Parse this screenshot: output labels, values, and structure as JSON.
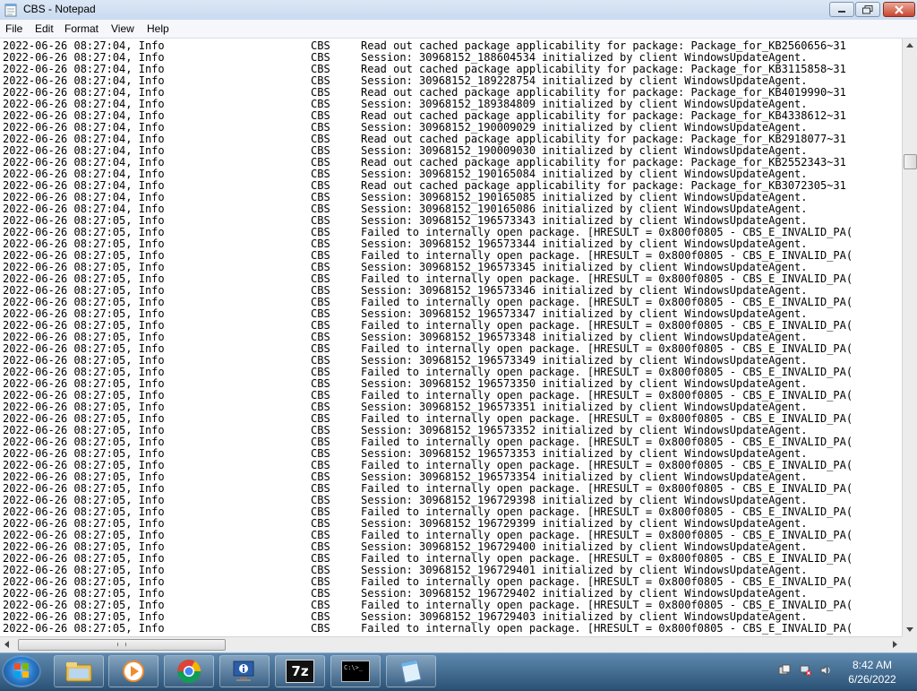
{
  "window": {
    "title": "CBS - Notepad"
  },
  "menu": [
    "File",
    "Edit",
    "Format",
    "View",
    "Help"
  ],
  "log_lines": [
    {
      "date": "2022-06-26 08:27:04, Info",
      "src": "CBS",
      "msg": "Read out cached package applicability for package: Package_for_KB2560656~31"
    },
    {
      "date": "2022-06-26 08:27:04, Info",
      "src": "CBS",
      "msg": "Session: 30968152_188604534 initialized by client WindowsUpdateAgent."
    },
    {
      "date": "2022-06-26 08:27:04, Info",
      "src": "CBS",
      "msg": "Read out cached package applicability for package: Package_for_KB3115858~31"
    },
    {
      "date": "2022-06-26 08:27:04, Info",
      "src": "CBS",
      "msg": "Session: 30968152_189228754 initialized by client WindowsUpdateAgent."
    },
    {
      "date": "2022-06-26 08:27:04, Info",
      "src": "CBS",
      "msg": "Read out cached package applicability for package: Package_for_KB4019990~31"
    },
    {
      "date": "2022-06-26 08:27:04, Info",
      "src": "CBS",
      "msg": "Session: 30968152_189384809 initialized by client WindowsUpdateAgent."
    },
    {
      "date": "2022-06-26 08:27:04, Info",
      "src": "CBS",
      "msg": "Read out cached package applicability for package: Package_for_KB4338612~31"
    },
    {
      "date": "2022-06-26 08:27:04, Info",
      "src": "CBS",
      "msg": "Session: 30968152_190009029 initialized by client WindowsUpdateAgent."
    },
    {
      "date": "2022-06-26 08:27:04, Info",
      "src": "CBS",
      "msg": "Read out cached package applicability for package: Package_for_KB2918077~31"
    },
    {
      "date": "2022-06-26 08:27:04, Info",
      "src": "CBS",
      "msg": "Session: 30968152_190009030 initialized by client WindowsUpdateAgent."
    },
    {
      "date": "2022-06-26 08:27:04, Info",
      "src": "CBS",
      "msg": "Read out cached package applicability for package: Package_for_KB2552343~31"
    },
    {
      "date": "2022-06-26 08:27:04, Info",
      "src": "CBS",
      "msg": "Session: 30968152_190165084 initialized by client WindowsUpdateAgent."
    },
    {
      "date": "2022-06-26 08:27:04, Info",
      "src": "CBS",
      "msg": "Read out cached package applicability for package: Package_for_KB3072305~31"
    },
    {
      "date": "2022-06-26 08:27:04, Info",
      "src": "CBS",
      "msg": "Session: 30968152_190165085 initialized by client WindowsUpdateAgent."
    },
    {
      "date": "2022-06-26 08:27:04, Info",
      "src": "CBS",
      "msg": "Session: 30968152_190165086 initialized by client WindowsUpdateAgent."
    },
    {
      "date": "2022-06-26 08:27:05, Info",
      "src": "CBS",
      "msg": "Session: 30968152_196573343 initialized by client WindowsUpdateAgent."
    },
    {
      "date": "2022-06-26 08:27:05, Info",
      "src": "CBS",
      "msg": "Failed to internally open package. [HRESULT = 0x800f0805 - CBS_E_INVALID_PA("
    },
    {
      "date": "2022-06-26 08:27:05, Info",
      "src": "CBS",
      "msg": "Session: 30968152_196573344 initialized by client WindowsUpdateAgent."
    },
    {
      "date": "2022-06-26 08:27:05, Info",
      "src": "CBS",
      "msg": "Failed to internally open package. [HRESULT = 0x800f0805 - CBS_E_INVALID_PA("
    },
    {
      "date": "2022-06-26 08:27:05, Info",
      "src": "CBS",
      "msg": "Session: 30968152_196573345 initialized by client WindowsUpdateAgent."
    },
    {
      "date": "2022-06-26 08:27:05, Info",
      "src": "CBS",
      "msg": "Failed to internally open package. [HRESULT = 0x800f0805 - CBS_E_INVALID_PA("
    },
    {
      "date": "2022-06-26 08:27:05, Info",
      "src": "CBS",
      "msg": "Session: 30968152_196573346 initialized by client WindowsUpdateAgent."
    },
    {
      "date": "2022-06-26 08:27:05, Info",
      "src": "CBS",
      "msg": "Failed to internally open package. [HRESULT = 0x800f0805 - CBS_E_INVALID_PA("
    },
    {
      "date": "2022-06-26 08:27:05, Info",
      "src": "CBS",
      "msg": "Session: 30968152_196573347 initialized by client WindowsUpdateAgent."
    },
    {
      "date": "2022-06-26 08:27:05, Info",
      "src": "CBS",
      "msg": "Failed to internally open package. [HRESULT = 0x800f0805 - CBS_E_INVALID_PA("
    },
    {
      "date": "2022-06-26 08:27:05, Info",
      "src": "CBS",
      "msg": "Session: 30968152_196573348 initialized by client WindowsUpdateAgent."
    },
    {
      "date": "2022-06-26 08:27:05, Info",
      "src": "CBS",
      "msg": "Failed to internally open package. [HRESULT = 0x800f0805 - CBS_E_INVALID_PA("
    },
    {
      "date": "2022-06-26 08:27:05, Info",
      "src": "CBS",
      "msg": "Session: 30968152_196573349 initialized by client WindowsUpdateAgent."
    },
    {
      "date": "2022-06-26 08:27:05, Info",
      "src": "CBS",
      "msg": "Failed to internally open package. [HRESULT = 0x800f0805 - CBS_E_INVALID_PA("
    },
    {
      "date": "2022-06-26 08:27:05, Info",
      "src": "CBS",
      "msg": "Session: 30968152_196573350 initialized by client WindowsUpdateAgent."
    },
    {
      "date": "2022-06-26 08:27:05, Info",
      "src": "CBS",
      "msg": "Failed to internally open package. [HRESULT = 0x800f0805 - CBS_E_INVALID_PA("
    },
    {
      "date": "2022-06-26 08:27:05, Info",
      "src": "CBS",
      "msg": "Session: 30968152_196573351 initialized by client WindowsUpdateAgent."
    },
    {
      "date": "2022-06-26 08:27:05, Info",
      "src": "CBS",
      "msg": "Failed to internally open package. [HRESULT = 0x800f0805 - CBS_E_INVALID_PA("
    },
    {
      "date": "2022-06-26 08:27:05, Info",
      "src": "CBS",
      "msg": "Session: 30968152_196573352 initialized by client WindowsUpdateAgent."
    },
    {
      "date": "2022-06-26 08:27:05, Info",
      "src": "CBS",
      "msg": "Failed to internally open package. [HRESULT = 0x800f0805 - CBS_E_INVALID_PA("
    },
    {
      "date": "2022-06-26 08:27:05, Info",
      "src": "CBS",
      "msg": "Session: 30968152_196573353 initialized by client WindowsUpdateAgent."
    },
    {
      "date": "2022-06-26 08:27:05, Info",
      "src": "CBS",
      "msg": "Failed to internally open package. [HRESULT = 0x800f0805 - CBS_E_INVALID_PA("
    },
    {
      "date": "2022-06-26 08:27:05, Info",
      "src": "CBS",
      "msg": "Session: 30968152_196573354 initialized by client WindowsUpdateAgent."
    },
    {
      "date": "2022-06-26 08:27:05, Info",
      "src": "CBS",
      "msg": "Failed to internally open package. [HRESULT = 0x800f0805 - CBS_E_INVALID_PA("
    },
    {
      "date": "2022-06-26 08:27:05, Info",
      "src": "CBS",
      "msg": "Session: 30968152_196729398 initialized by client WindowsUpdateAgent."
    },
    {
      "date": "2022-06-26 08:27:05, Info",
      "src": "CBS",
      "msg": "Failed to internally open package. [HRESULT = 0x800f0805 - CBS_E_INVALID_PA("
    },
    {
      "date": "2022-06-26 08:27:05, Info",
      "src": "CBS",
      "msg": "Session: 30968152_196729399 initialized by client WindowsUpdateAgent."
    },
    {
      "date": "2022-06-26 08:27:05, Info",
      "src": "CBS",
      "msg": "Failed to internally open package. [HRESULT = 0x800f0805 - CBS_E_INVALID_PA("
    },
    {
      "date": "2022-06-26 08:27:05, Info",
      "src": "CBS",
      "msg": "Session: 30968152_196729400 initialized by client WindowsUpdateAgent."
    },
    {
      "date": "2022-06-26 08:27:05, Info",
      "src": "CBS",
      "msg": "Failed to internally open package. [HRESULT = 0x800f0805 - CBS_E_INVALID_PA("
    },
    {
      "date": "2022-06-26 08:27:05, Info",
      "src": "CBS",
      "msg": "Session: 30968152_196729401 initialized by client WindowsUpdateAgent."
    },
    {
      "date": "2022-06-26 08:27:05, Info",
      "src": "CBS",
      "msg": "Failed to internally open package. [HRESULT = 0x800f0805 - CBS_E_INVALID_PA("
    },
    {
      "date": "2022-06-26 08:27:05, Info",
      "src": "CBS",
      "msg": "Session: 30968152_196729402 initialized by client WindowsUpdateAgent."
    },
    {
      "date": "2022-06-26 08:27:05, Info",
      "src": "CBS",
      "msg": "Failed to internally open package. [HRESULT = 0x800f0805 - CBS_E_INVALID_PA("
    },
    {
      "date": "2022-06-26 08:27:05, Info",
      "src": "CBS",
      "msg": "Session: 30968152_196729403 initialized by client WindowsUpdateAgent."
    },
    {
      "date": "2022-06-26 08:27:05, Info",
      "src": "CBS",
      "msg": "Failed to internally open package. [HRESULT = 0x800f0805 - CBS_E_INVALID_PA("
    }
  ],
  "taskbar": {
    "apps": [
      {
        "name": "windows-explorer-icon"
      },
      {
        "name": "media-player-icon"
      },
      {
        "name": "chrome-icon"
      },
      {
        "name": "system-info-icon"
      },
      {
        "name": "7zip-icon",
        "label": "7z"
      },
      {
        "name": "command-prompt-icon",
        "label": "C:\\>_"
      },
      {
        "name": "notepad-icon"
      }
    ],
    "clock": {
      "time": "8:42 AM",
      "date": "6/26/2022"
    }
  },
  "colors": {
    "taskbar": "#3a6488",
    "editor_bg": "#ffffff",
    "close_button": "#c8452f"
  }
}
